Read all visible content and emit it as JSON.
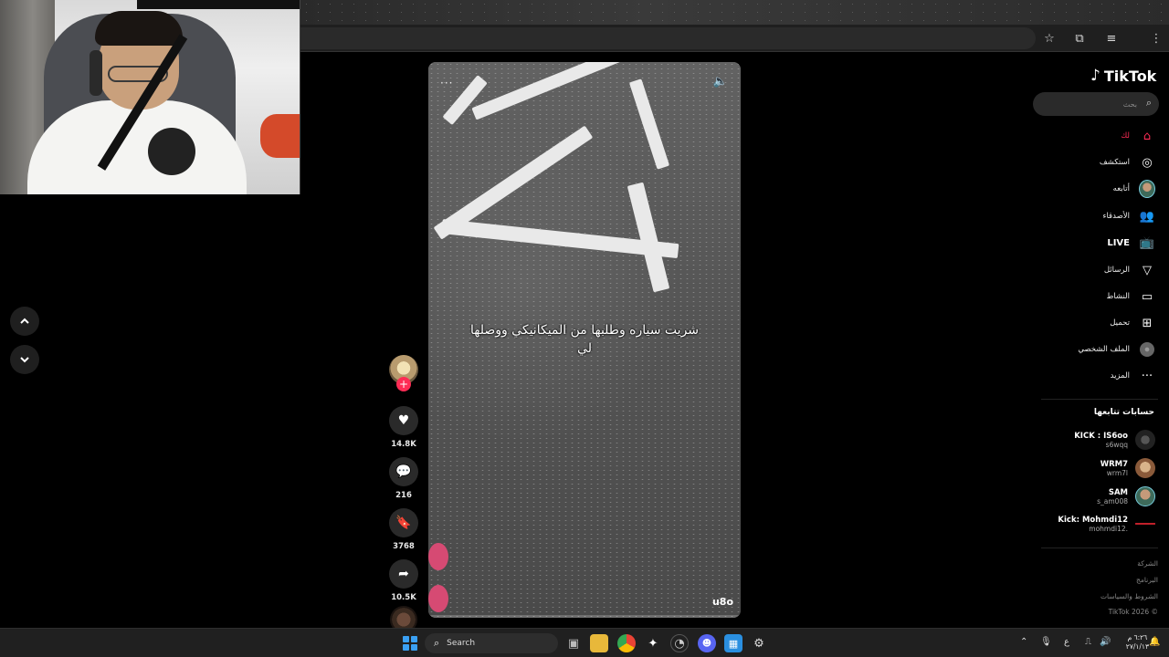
{
  "browser": {
    "toolbar_icons": [
      "star-icon",
      "extensions-icon",
      "media-control-icon",
      "kebab-menu-icon"
    ]
  },
  "video": {
    "caption": "شريت سياره وطلبها من الميكانيكي ووصلها لي",
    "watermark": "u8o",
    "dots": "···",
    "progress": 0.0
  },
  "actions": {
    "likes": "14.8K",
    "comments": "216",
    "saves": "3768",
    "shares": "10.5K"
  },
  "sidebar": {
    "logo_text": "TikTok",
    "search_placeholder": "بحث",
    "menu": [
      {
        "label": "لك",
        "icon": "home-icon",
        "active": true
      },
      {
        "label": "استكشف",
        "icon": "compass-icon"
      },
      {
        "label": "أتابعه",
        "icon": "avatar"
      },
      {
        "label": "الأصدقاء",
        "icon": "friends-icon"
      },
      {
        "label": "LIVE",
        "icon": "live-tv-icon"
      },
      {
        "label": "الرسائل",
        "icon": "send-icon"
      },
      {
        "label": "النشاط",
        "icon": "message-icon"
      },
      {
        "label": "تحميل",
        "icon": "upload-icon"
      },
      {
        "label": "الملف الشخصي",
        "icon": "profile-avatar"
      },
      {
        "label": "المزيد",
        "icon": "more-icon"
      }
    ],
    "following_title": "حسابات تتابعها",
    "following": [
      {
        "name": "KICK : IS6oo",
        "handle": "s6wqq"
      },
      {
        "name": "WRM7",
        "handle": "wrm7l"
      },
      {
        "name": "SAM",
        "handle": "s_am008"
      },
      {
        "name": "Kick: Mohmdi12",
        "handle": "mohmdi12."
      }
    ],
    "footer": [
      "الشركة",
      "البرنامج",
      "الشروط والسياسات",
      "TikTok 2026 ©"
    ]
  },
  "taskbar": {
    "search_label": "Search",
    "tray_lang": "ع",
    "clock_time": "٦:٢٦ م",
    "clock_date": "٢٧/١/١٣"
  },
  "colors": {
    "accent": "#fe2c55",
    "background": "#000000",
    "taskbar": "#202020"
  }
}
